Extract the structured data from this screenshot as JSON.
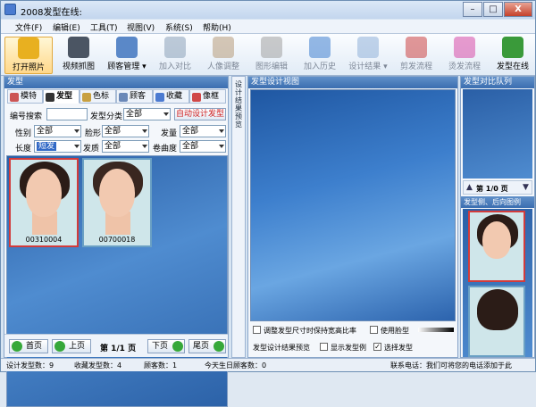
{
  "window": {
    "title": "2008发型在线:",
    "min": "–",
    "max": "□",
    "close": "X"
  },
  "menu": [
    "文件(F)",
    "编辑(E)",
    "工具(T)",
    "视图(V)",
    "系统(S)",
    "帮助(H)"
  ],
  "toolbar": [
    {
      "label": "打开照片",
      "icon": "open-photo-icon",
      "color": "#e8b020",
      "active": true
    },
    {
      "label": "视频抓图",
      "icon": "camera-icon",
      "color": "#4b5563"
    },
    {
      "label": "顾客管理 ▾",
      "icon": "customer-icon",
      "color": "#5a88c8"
    },
    {
      "label": "加入对比",
      "icon": "compare-icon",
      "color": "#8aa0b8",
      "disabled": true
    },
    {
      "label": "人像调整",
      "icon": "portrait-adjust-icon",
      "color": "#b79a7a",
      "disabled": true
    },
    {
      "label": "图形编辑",
      "icon": "graphic-edit-icon",
      "color": "#a0a0a0",
      "disabled": true
    },
    {
      "label": "加入历史",
      "icon": "history-icon",
      "color": "#3f7fd0",
      "disabled": true
    },
    {
      "label": "设计结果 ▾",
      "icon": "result-icon",
      "color": "#8fb0d8",
      "disabled": true
    },
    {
      "label": "剪发流程",
      "icon": "scissors-icon",
      "color": "#c44",
      "disabled": true
    },
    {
      "label": "烫发流程",
      "icon": "perm-icon",
      "color": "#d74ba8",
      "disabled": true
    },
    {
      "label": "发型在线",
      "icon": "online-icon",
      "color": "#3a9a3a"
    }
  ],
  "left": {
    "header": "发型",
    "tabs": [
      {
        "label": "模特",
        "icon": "model-icon",
        "color": "#c55"
      },
      {
        "label": "发型",
        "icon": "hairstyle-icon",
        "color": "#333",
        "selected": true
      },
      {
        "label": "色标",
        "icon": "color-chart-icon",
        "color": "#c8a040"
      },
      {
        "label": "顾客",
        "icon": "customer-tab-icon",
        "color": "#6a88b8"
      },
      {
        "label": "收藏",
        "icon": "favorite-icon",
        "color": "#4c7bd1"
      },
      {
        "label": "像框",
        "icon": "frame-icon",
        "color": "#d04848"
      }
    ],
    "search_label": "编号搜索",
    "search_value": "",
    "category_label": "发型分类",
    "category_value": "全部",
    "auto_design": "自动设计发型",
    "filters": [
      {
        "label": "性别",
        "value": "全部"
      },
      {
        "label": "脸形",
        "value": "全部"
      },
      {
        "label": "发量",
        "value": "全部"
      },
      {
        "label": "长度",
        "value": "短发"
      },
      {
        "label": "发质",
        "value": "全部"
      },
      {
        "label": "卷曲度",
        "value": "全部"
      }
    ],
    "thumbs": [
      {
        "code": "00310004"
      },
      {
        "code": "00700018"
      }
    ],
    "pager": {
      "first": "首页",
      "prev": "上页",
      "page": "第 1/1 页",
      "next": "下页",
      "last": "尾页"
    }
  },
  "splitter_text": "设计结果预览",
  "design": {
    "header": "发型设计视图",
    "opt1": "调整发型尺寸时保持宽高比率",
    "opt2": "使用脸型",
    "bottom_label": "发型设计结果预览",
    "opt3": "显示发型例",
    "opt4": "选择发型"
  },
  "right": {
    "header": "发型对比队列",
    "page": "第 1/0 页",
    "sample_header": "发型侧、后向图例"
  },
  "status": {
    "designs": "设计发型数：9",
    "favorites": "收藏发型数：4",
    "customers": "顾客数：1",
    "birthdays": "今天生日顾客数：0",
    "contact": "联系电话：我们可将您的电话添加于此"
  },
  "colors": {
    "accent": "#3b6eb0",
    "panel": "#f4f7fb",
    "blue_bg": "#2f66b0"
  }
}
